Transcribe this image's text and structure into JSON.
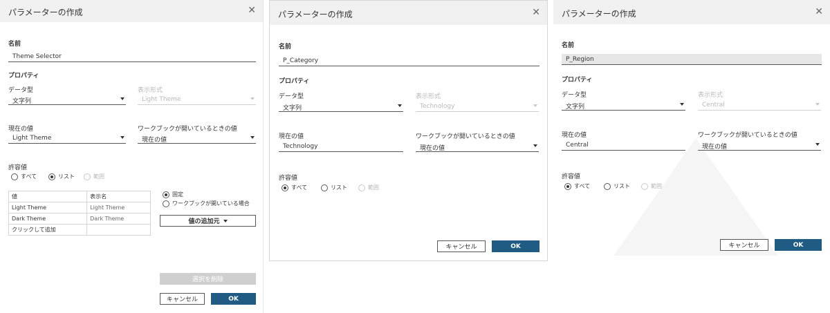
{
  "common": {
    "title": "パラメーターの作成",
    "close_glyph": "✕",
    "name_label": "名前",
    "properties_label": "プロパティ",
    "data_type_label": "データ型",
    "display_format_label": "表示形式",
    "current_value_label": "現在の値",
    "workbook_open_label": "ワークブックが開いているときの値",
    "allowed_values_label": "許容値",
    "allowed_all": "すべて",
    "allowed_list": "リスト",
    "allowed_range": "範囲",
    "cancel": "キャンセル",
    "ok": "OK"
  },
  "dialog1": {
    "name_value": "Theme Selector",
    "data_type": "文字列",
    "display_format": "Light Theme",
    "current_value": "Light Theme",
    "workbook_open_value": "現在の値",
    "allowed_selected": "list",
    "table": {
      "headers": [
        "値",
        "表示名"
      ],
      "rows": [
        [
          "Light Theme",
          "Light Theme"
        ],
        [
          "Dark Theme",
          "Dark Theme"
        ],
        [
          "クリックして追加",
          ""
        ]
      ]
    },
    "fixed_label": "固定",
    "when_open_label": "ワークブックが開いている場合",
    "add_values_label": "値の追加元",
    "remove_selection_label": "選択を削除"
  },
  "dialog2": {
    "name_value": "P_Category",
    "data_type": "文字列",
    "display_format": "Technology",
    "current_value": "Technology",
    "workbook_open_value": "現在の値",
    "allowed_selected": "all"
  },
  "dialog3": {
    "name_value": "P_Region",
    "data_type": "文字列",
    "display_format": "Central",
    "current_value": "Central",
    "workbook_open_value": "現在の値",
    "allowed_selected": "all"
  },
  "colors": {
    "primary_button": "#1f5b82",
    "header_bg": "#f0f0f0",
    "disabled_text": "#b8b8b8"
  }
}
